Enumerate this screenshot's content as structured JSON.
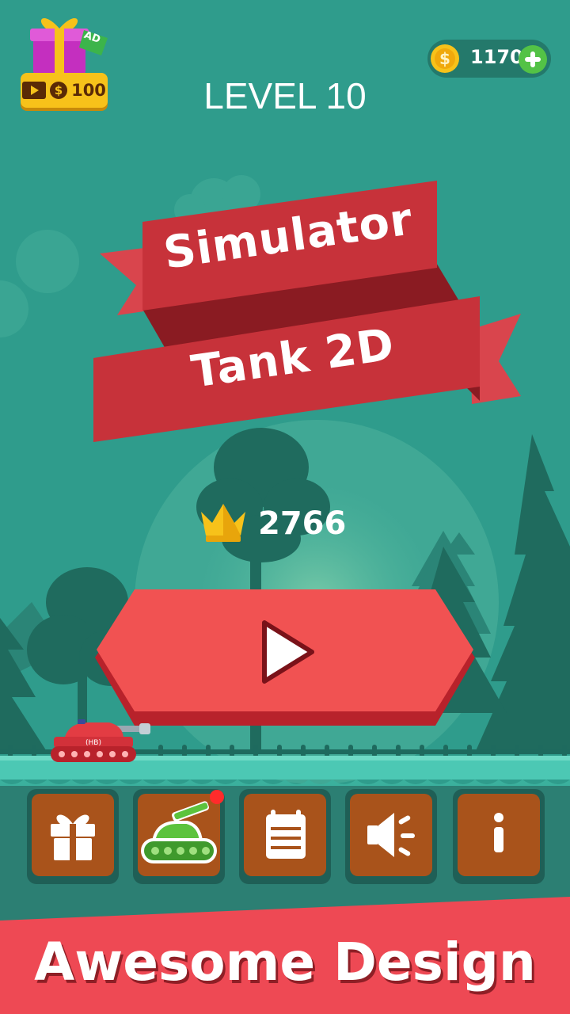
{
  "hud": {
    "ad_badge": "AD",
    "ad_reward": "100",
    "coins": "1170",
    "level": "LEVEL 10"
  },
  "title": {
    "line1": "Simulator",
    "line2": "Tank 2D"
  },
  "best_score": "2766",
  "tank_plate": "(HB)",
  "menu": [
    {
      "name": "gift",
      "icon": "gift-icon"
    },
    {
      "name": "tanks",
      "icon": "tank-icon",
      "notification": true
    },
    {
      "name": "calendar",
      "icon": "calendar-icon"
    },
    {
      "name": "sound",
      "icon": "speaker-icon"
    },
    {
      "name": "info",
      "icon": "info-icon"
    }
  ],
  "footer": "Awesome Design",
  "colors": {
    "background": "#2f9c8c",
    "banner_red": "#c7323a",
    "play_red": "#f15252",
    "button_brown": "#a9531b",
    "footer_red": "#ee4954",
    "gold": "#f7c21a"
  }
}
